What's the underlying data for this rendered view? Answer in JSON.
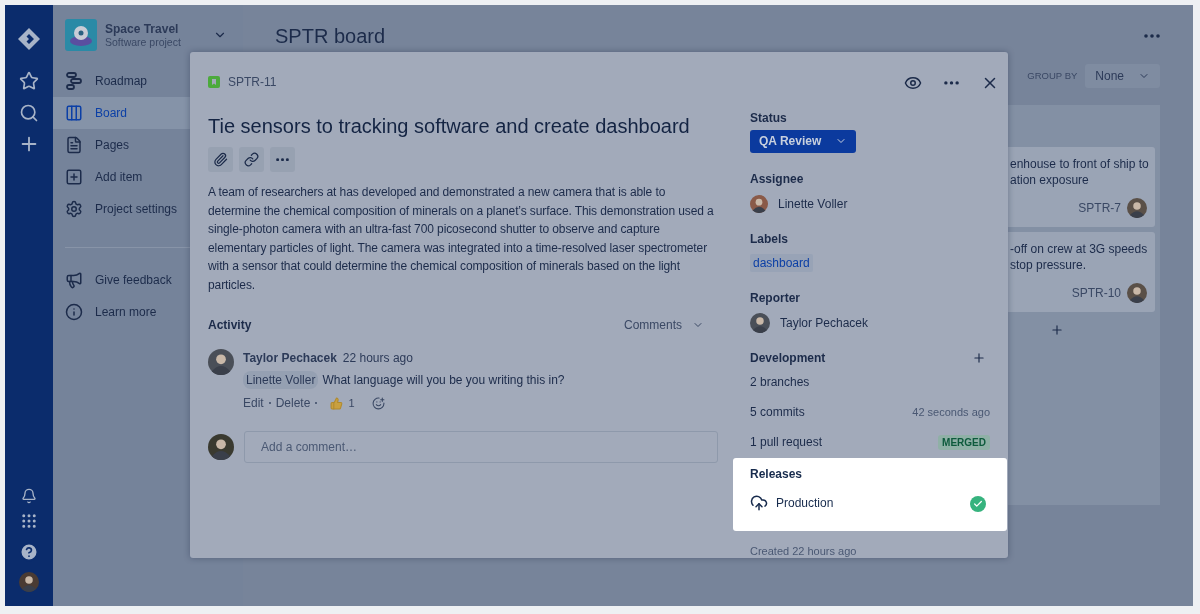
{
  "project": {
    "name": "Space Travel",
    "type": "Software project"
  },
  "sidebar": {
    "items": [
      {
        "label": "Roadmap",
        "selected": false
      },
      {
        "label": "Board",
        "selected": true
      },
      {
        "label": "Pages",
        "selected": false
      },
      {
        "label": "Add item",
        "selected": false
      },
      {
        "label": "Project settings",
        "selected": false
      }
    ],
    "footer_items": [
      {
        "label": "Give feedback"
      },
      {
        "label": "Learn more"
      }
    ]
  },
  "board": {
    "title": "SPTR board",
    "group_by_label": "GROUP BY",
    "group_by_value": "None",
    "cards": [
      {
        "lines": [
          "enhouse to front of ship to",
          "ation exposure"
        ],
        "key": "SPTR-7"
      },
      {
        "lines": [
          "-off on crew at 3G speeds",
          "stop pressure."
        ],
        "key": "SPTR-10"
      }
    ]
  },
  "issue": {
    "key": "SPTR-11",
    "title": "Tie sensors to tracking software and create dashboard",
    "description": "A team of researchers at has developed and demonstrated a new camera that is able to determine the chemical composition of minerals on a planet’s surface. This demonstration used a single-photon camera with an ultra-fast 700 picosecond shutter to observe and capture elementary particles of light. The camera was integrated into a time-resolved laser spectrometer with a sensor that could determine the chemical composition of minerals based on the light particles.",
    "activity_heading": "Activity",
    "activity_filter": "Comments",
    "comments": [
      {
        "author": "Taylor Pechacek",
        "time": "22 hours ago",
        "mention": "Linette Voller",
        "text": "What language will you be you writing this in?",
        "actions": [
          "Edit",
          "Delete"
        ],
        "reaction_count": "1"
      }
    ],
    "comment_placeholder": "Add a comment…"
  },
  "details": {
    "status_label": "Status",
    "status": "QA Review",
    "assignee_label": "Assignee",
    "assignee": "Linette Voller",
    "labels_label": "Labels",
    "labels": [
      "dashboard"
    ],
    "reporter_label": "Reporter",
    "reporter": "Taylor Pechacek",
    "development_label": "Development",
    "development": [
      {
        "kind": "plain",
        "text": "2 branches"
      },
      {
        "kind": "time",
        "text": "5 commits",
        "meta": "42 seconds ago"
      },
      {
        "kind": "badge",
        "text": "1 pull request",
        "meta": "MERGED"
      }
    ],
    "releases_label": "Releases",
    "releases": [
      {
        "name": "Production",
        "released": true
      }
    ],
    "created": "Created 22 hours ago"
  }
}
